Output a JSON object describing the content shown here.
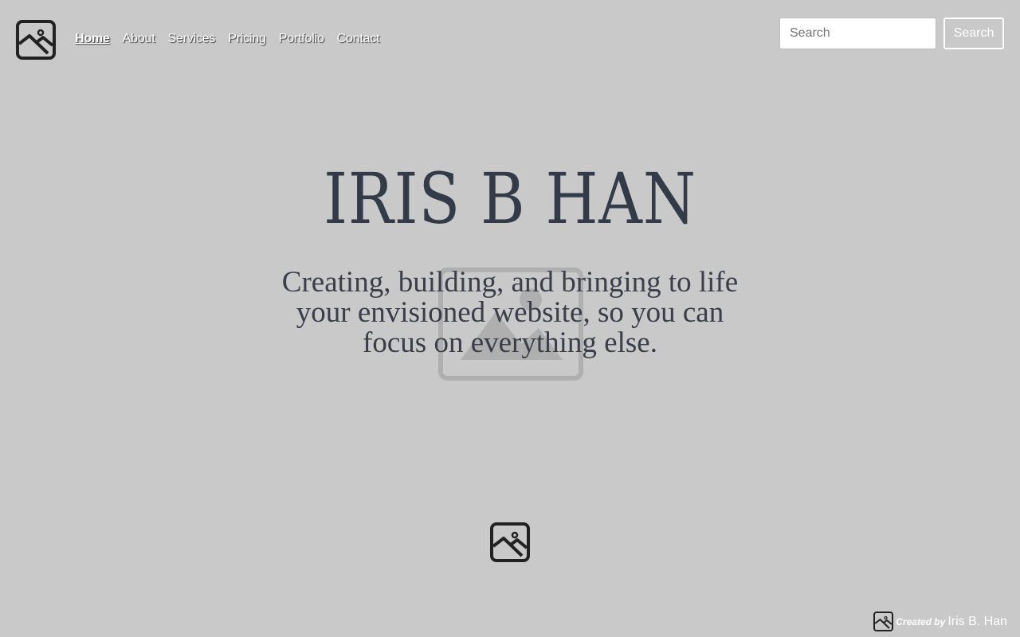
{
  "nav": {
    "items": [
      {
        "label": "Home",
        "active": true
      },
      {
        "label": "About"
      },
      {
        "label": "Services"
      },
      {
        "label": "Pricing"
      },
      {
        "label": "Portfolio"
      },
      {
        "label": "Contact"
      }
    ]
  },
  "search": {
    "placeholder": "Search",
    "button_label": "Search"
  },
  "hero": {
    "title": "IRIS B HAN",
    "subtitle": "Creating, building, and bringing to life your envisioned website, so you can focus on everything else."
  },
  "footer": {
    "created_by": "Created by",
    "name": "Iris B. Han"
  },
  "icons": {
    "logo": "image-icon",
    "background": "image-placeholder-icon",
    "center": "image-icon",
    "credit": "image-icon"
  },
  "colors": {
    "background": "#c9c9c9",
    "title": "#333a48",
    "nav_text": "#ffffff"
  }
}
